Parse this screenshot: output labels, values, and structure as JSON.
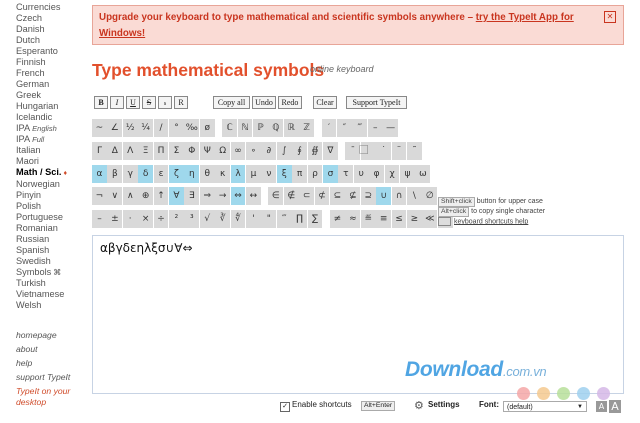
{
  "sidebar": {
    "languages": [
      {
        "label": "Currencies"
      },
      {
        "label": "Czech"
      },
      {
        "label": "Danish"
      },
      {
        "label": "Dutch"
      },
      {
        "label": "Esperanto"
      },
      {
        "label": "Finnish"
      },
      {
        "label": "French"
      },
      {
        "label": "German"
      },
      {
        "label": "Greek"
      },
      {
        "label": "Hungarian"
      },
      {
        "label": "Icelandic"
      },
      {
        "label": "IPA",
        "note": "English"
      },
      {
        "label": "IPA",
        "note": "Full"
      },
      {
        "label": "Italian"
      },
      {
        "label": "Maori"
      },
      {
        "label": "Math / Sci.",
        "active": true,
        "mark": "♦"
      },
      {
        "label": "Norwegian"
      },
      {
        "label": "Pinyin"
      },
      {
        "label": "Polish"
      },
      {
        "label": "Portuguese"
      },
      {
        "label": "Romanian"
      },
      {
        "label": "Russian"
      },
      {
        "label": "Spanish"
      },
      {
        "label": "Swedish"
      },
      {
        "label": "Symbols",
        "sym": "⌘"
      },
      {
        "label": "Turkish"
      },
      {
        "label": "Vietnamese"
      },
      {
        "label": "Welsh"
      }
    ],
    "links": {
      "homepage": "homepage",
      "about": "about",
      "help": "help",
      "support": "support TypeIt",
      "promo": "TypeIt on your desktop"
    }
  },
  "banner": {
    "text": "Upgrade your keyboard to type mathematical and scientific symbols anywhere –",
    "link": "try the TypeIt App for Windows!",
    "close": "✕",
    "bg_color": "#fadbd5",
    "text_color": "#c9351f"
  },
  "header": {
    "title": "Type mathematical symbols",
    "subtitle": "online keyboard",
    "title_color": "#e2502c"
  },
  "format_buttons": {
    "bold": "B",
    "italic": "I",
    "underline": "U",
    "strike": "S",
    "subscript": "s",
    "superscript": "R",
    "copy_all": "Copy all",
    "undo": "Undo",
    "redo": "Redo",
    "clear": "Clear",
    "support": "Support TypeIt"
  },
  "keyboard": {
    "highlight_color": "#9fd8ec",
    "key_color": "#d9d9d9",
    "rows": [
      [
        {
          "c": "~"
        },
        {
          "c": "∠"
        },
        {
          "c": "½"
        },
        {
          "c": "¼"
        },
        {
          "c": "/"
        },
        {
          "c": "°"
        },
        {
          "c": "‰"
        },
        {
          "c": "ø"
        },
        {
          "c": "",
          "gap": true
        },
        {
          "c": "ℂ"
        },
        {
          "c": "ℕ"
        },
        {
          "c": "ℙ"
        },
        {
          "c": "ℚ"
        },
        {
          "c": "ℝ"
        },
        {
          "c": "ℤ"
        },
        {
          "c": "",
          "gap": true
        },
        {
          "c": "′"
        },
        {
          "c": "″"
        },
        {
          "c": "‴"
        },
        {
          "c": "–"
        },
        {
          "c": "—"
        }
      ],
      [
        {
          "c": "Γ"
        },
        {
          "c": "Δ"
        },
        {
          "c": "Λ"
        },
        {
          "c": "Ξ"
        },
        {
          "c": "Π"
        },
        {
          "c": "Σ"
        },
        {
          "c": "Φ"
        },
        {
          "c": "Ψ"
        },
        {
          "c": "Ω"
        },
        {
          "c": "∞"
        },
        {
          "c": "∘"
        },
        {
          "c": "∂"
        },
        {
          "c": "∫"
        },
        {
          "c": "∮"
        },
        {
          "c": "∯"
        },
        {
          "c": "∇"
        },
        {
          "c": "",
          "gap": true
        },
        {
          "c": "¯"
        },
        {
          "c": "⃞"
        },
        {
          "c": "˙"
        },
        {
          "c": "¨"
        },
        {
          "c": "˜"
        }
      ],
      [
        {
          "c": "α",
          "hl": true
        },
        {
          "c": "β"
        },
        {
          "c": "γ"
        },
        {
          "c": "δ",
          "hl": true
        },
        {
          "c": "ε"
        },
        {
          "c": "ζ",
          "hl": true
        },
        {
          "c": "η",
          "hl": true
        },
        {
          "c": "θ"
        },
        {
          "c": "κ"
        },
        {
          "c": "λ",
          "hl": true
        },
        {
          "c": "μ"
        },
        {
          "c": "ν"
        },
        {
          "c": "ξ",
          "hl": true
        },
        {
          "c": "π"
        },
        {
          "c": "ρ"
        },
        {
          "c": "σ",
          "hl": true
        },
        {
          "c": "τ"
        },
        {
          "c": "υ"
        },
        {
          "c": "φ"
        },
        {
          "c": "χ"
        },
        {
          "c": "ψ"
        },
        {
          "c": "ω"
        }
      ],
      [
        {
          "c": "¬"
        },
        {
          "c": "∨"
        },
        {
          "c": "∧"
        },
        {
          "c": "⊕"
        },
        {
          "c": "↑"
        },
        {
          "c": "∀",
          "hl": true
        },
        {
          "c": "∃"
        },
        {
          "c": "⇒"
        },
        {
          "c": "→"
        },
        {
          "c": "⇔",
          "hl": true
        },
        {
          "c": "↔"
        },
        {
          "c": "",
          "gap": true
        },
        {
          "c": "∈"
        },
        {
          "c": "∉"
        },
        {
          "c": "⊂"
        },
        {
          "c": "⊄"
        },
        {
          "c": "⊆"
        },
        {
          "c": "⊈"
        },
        {
          "c": "⊇"
        },
        {
          "c": "∪",
          "hl": true
        },
        {
          "c": "∩"
        },
        {
          "c": "\\"
        },
        {
          "c": "∅"
        }
      ],
      [
        {
          "c": "–"
        },
        {
          "c": "±"
        },
        {
          "c": "·"
        },
        {
          "c": "×"
        },
        {
          "c": "÷"
        },
        {
          "c": "²"
        },
        {
          "c": "³"
        },
        {
          "c": "√"
        },
        {
          "c": "∛"
        },
        {
          "c": "∜"
        },
        {
          "c": "'"
        },
        {
          "c": "\""
        },
        {
          "c": "‴"
        },
        {
          "c": "∏"
        },
        {
          "c": "∑"
        },
        {
          "c": "",
          "gap": true
        },
        {
          "c": "≠"
        },
        {
          "c": "≈"
        },
        {
          "c": "≝"
        },
        {
          "c": "≡"
        },
        {
          "c": "≤"
        },
        {
          "c": "≥"
        },
        {
          "c": "≪"
        },
        {
          "c": "≫"
        }
      ]
    ]
  },
  "hints": {
    "shift_key": "Shift+click",
    "shift_text": "button for upper case",
    "alt_key": "Alt+click",
    "alt_text": "to copy single character",
    "shortcuts_help": "keyboard shortcuts help"
  },
  "editor": {
    "value": "αβγδεηλξσ∪∀⇔"
  },
  "bottom": {
    "enable_shortcuts": "Enable shortcuts",
    "shortcut_key": "Alt+Enter",
    "settings": "Settings",
    "font_label": "Font:",
    "font_value": "(default)",
    "font_smaller": "A",
    "font_larger": "A"
  },
  "watermark": {
    "text": "Download",
    "domain": ".com.vn",
    "dot_colors": [
      "#f4a7a7",
      "#f5c98f",
      "#b7df9a",
      "#9fd0ee",
      "#d5b7e6"
    ]
  }
}
